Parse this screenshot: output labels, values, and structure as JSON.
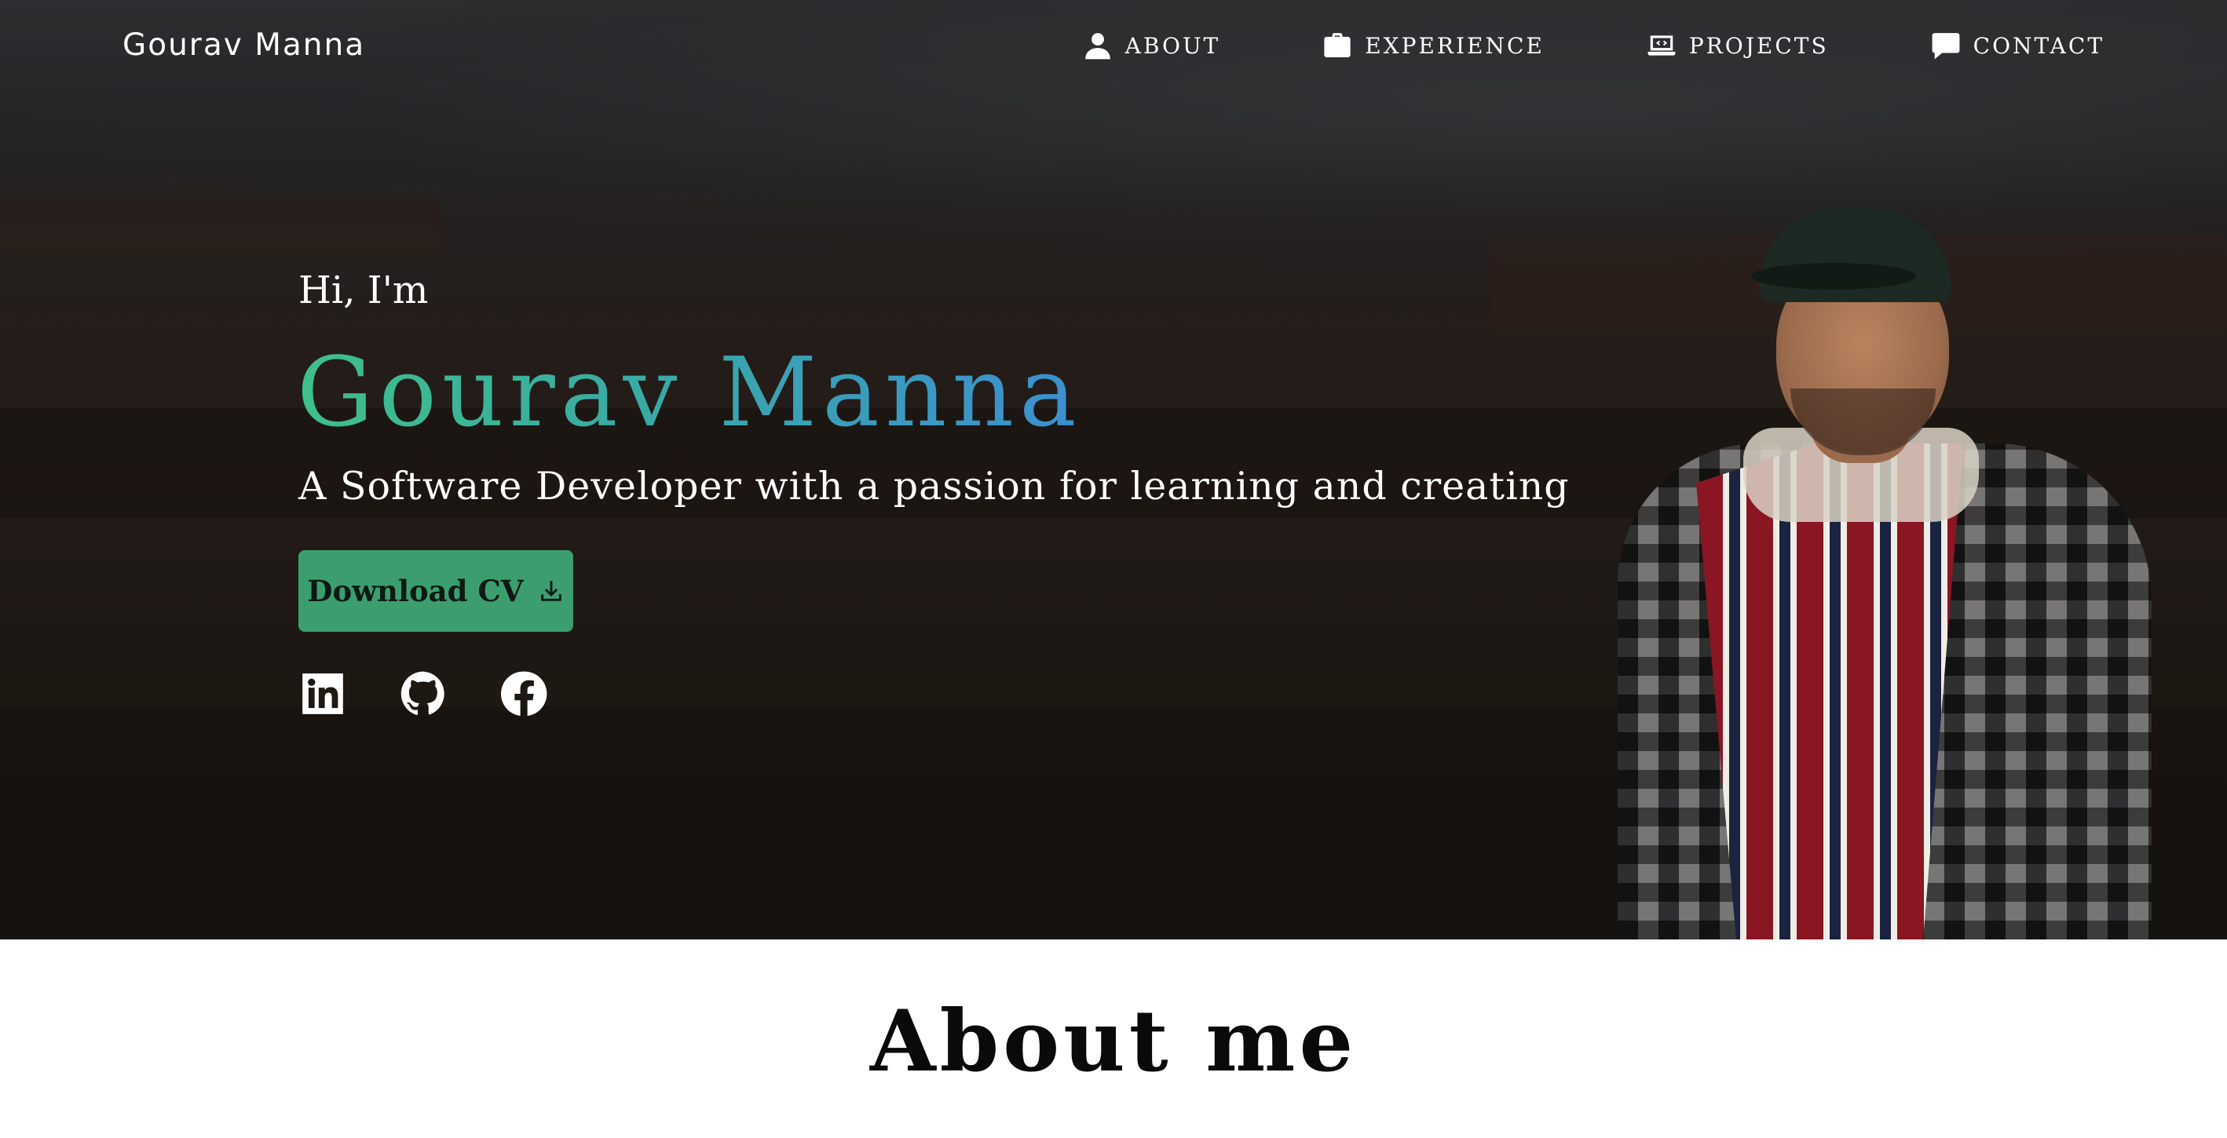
{
  "nav": {
    "brand": "Gourav Manna",
    "items": [
      {
        "label": "ABOUT",
        "icon": "user-icon"
      },
      {
        "label": "EXPERIENCE",
        "icon": "briefcase-icon"
      },
      {
        "label": "PROJECTS",
        "icon": "laptop-code-icon"
      },
      {
        "label": "CONTACT",
        "icon": "chat-bubble-icon"
      }
    ]
  },
  "hero": {
    "greeting": "Hi, I'm",
    "name": "Gourav Manna",
    "tagline": "A Software Developer with a passion for learning and creating",
    "cv_button_label": "Download CV",
    "name_gradient": [
      "#3ec08a",
      "#3b8fd1"
    ],
    "button_color": "#3c9e6f",
    "socials": [
      {
        "icon": "linkedin-icon"
      },
      {
        "icon": "github-icon"
      },
      {
        "icon": "facebook-icon"
      }
    ]
  },
  "about": {
    "title": "About me"
  }
}
